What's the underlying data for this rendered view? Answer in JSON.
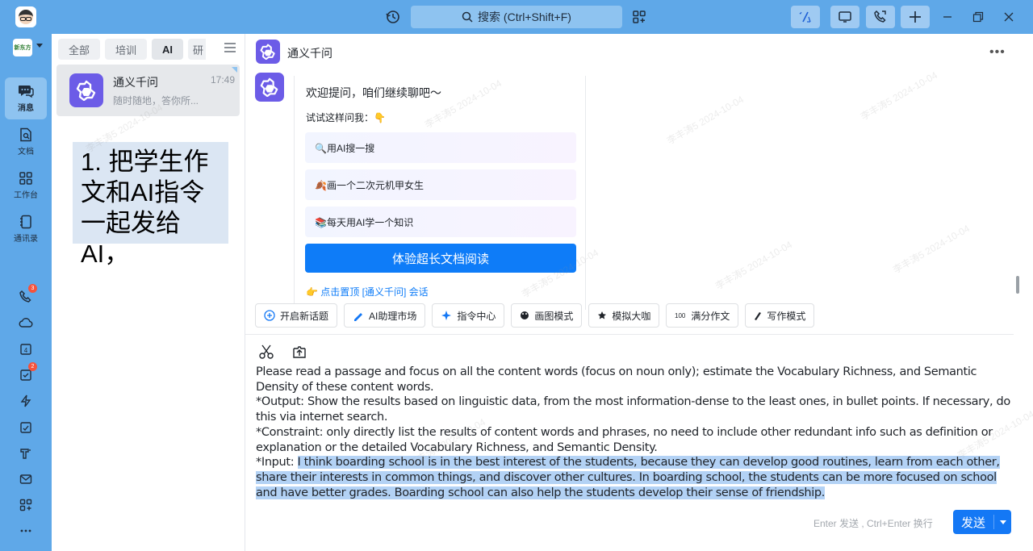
{
  "titlebar": {
    "search_placeholder": "搜索 (Ctrl+Shift+F)"
  },
  "leftnav": {
    "org_logo_text": "新东方",
    "items": [
      {
        "label": "消息",
        "icon": "chat-bubble-icon",
        "active": true
      },
      {
        "label": "文档",
        "icon": "document-icon",
        "active": false
      },
      {
        "label": "工作台",
        "icon": "grid-icon",
        "active": false
      },
      {
        "label": "通讯录",
        "icon": "contacts-icon",
        "active": false
      }
    ],
    "badges": {
      "phone": "3",
      "tasks": "2"
    },
    "calendar_day": "4"
  },
  "chatlist": {
    "tabs": [
      "全部",
      "培训",
      "AI",
      "研"
    ],
    "active_tab": "AI",
    "items": [
      {
        "name": "通义千问",
        "time": "17:49",
        "preview": "随时随地，答你所..."
      }
    ],
    "annotation": "1. 把学生作文和AI指令一起发给AI，"
  },
  "chat": {
    "title": "通义千问",
    "welcome": "欢迎提问，咱们继续聊吧～",
    "try_label": "试试这样问我：👇",
    "suggestions": [
      "🔍用AI搜一搜",
      "🍂画一个二次元机甲女生",
      "📚每天用AI学一个知识"
    ],
    "primary_button": "体验超长文档阅读",
    "pin_link": "👉 点击置顶 [通义千问] 会话"
  },
  "toolbar": {
    "tools": [
      {
        "label": "开启新话题",
        "icon": "plus-circle-icon"
      },
      {
        "label": "AI助理市场",
        "icon": "pen-icon"
      },
      {
        "label": "指令中心",
        "icon": "sparkle-icon"
      },
      {
        "label": "画图模式",
        "icon": "palette-icon"
      },
      {
        "label": "模拟大咖",
        "icon": "star-icon"
      },
      {
        "label": "满分作文",
        "icon": "hundred-icon"
      },
      {
        "label": "写作模式",
        "icon": "writing-icon"
      }
    ]
  },
  "input": {
    "line1": "Please read a passage and focus on all the content words (focus on noun only); estimate the Vocabulary Richness, and Semantic Density of these content words.",
    "line2": "*Output: Show the results based on linguistic data, from the most information-dense to the least ones, in bullet points. If necessary, do this via internet search.",
    "line3": "*Constraint: only directly list the results of content words and phrases, no need to include other redundant info such as definition or explanation or the detailed Vocabulary Richness, and Semantic Density.",
    "line4_prefix": "*Input: ",
    "line4_selected": "I think boarding school is in the best interest of the students, because they can develop good routines, learn from each other, share their interests in common things, and discover other cultures. In boarding school, the students can be more focused on school and have better grades. Boarding school can also help the students develop their sense of friendship.",
    "hint": "Enter 发送 , Ctrl+Enter 换行",
    "send_label": "发送"
  },
  "watermark": "李丰涛5 2024-10-04",
  "colors": {
    "titlebar": "#5fa8e8",
    "accent": "#1478f5",
    "ai_avatar": "#6c5ce7",
    "selection": "#b3d2f5"
  }
}
